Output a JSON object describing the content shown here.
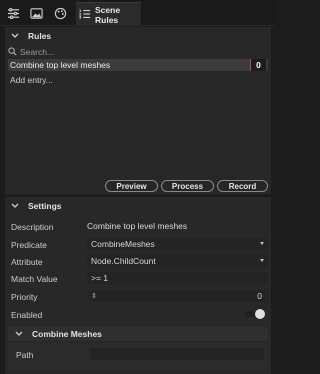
{
  "tabs": {
    "icons": [
      "sliders-icon",
      "image-icon",
      "palette-icon",
      "list-icon"
    ],
    "active_label": "Scene Rules"
  },
  "rules": {
    "header": "Rules",
    "search_placeholder": "Search...",
    "items": [
      {
        "label": "Combine top level meshes",
        "count": "0"
      }
    ],
    "add_entry": "Add entry..."
  },
  "actions": {
    "preview": "Preview",
    "process": "Process",
    "record": "Record"
  },
  "settings": {
    "header": "Settings",
    "rows": {
      "description": {
        "label": "Description",
        "value": "Combine top level meshes"
      },
      "predicate": {
        "label": "Predicate",
        "value": "CombineMeshes"
      },
      "attribute": {
        "label": "Attribute",
        "value": "Node.ChildCount"
      },
      "match_value": {
        "label": "Match Value",
        "value": ">= 1"
      },
      "priority": {
        "label": "Priority",
        "value": "0",
        "stepper": "⇕"
      },
      "enabled": {
        "label": "Enabled",
        "value": true
      }
    },
    "combine_meshes": {
      "header": "Combine Meshes",
      "path_label": "Path",
      "path_value": ""
    }
  },
  "colors": {
    "accent_red": "#b84848",
    "panel": "#282828",
    "selected_row": "#3c3c3c"
  }
}
